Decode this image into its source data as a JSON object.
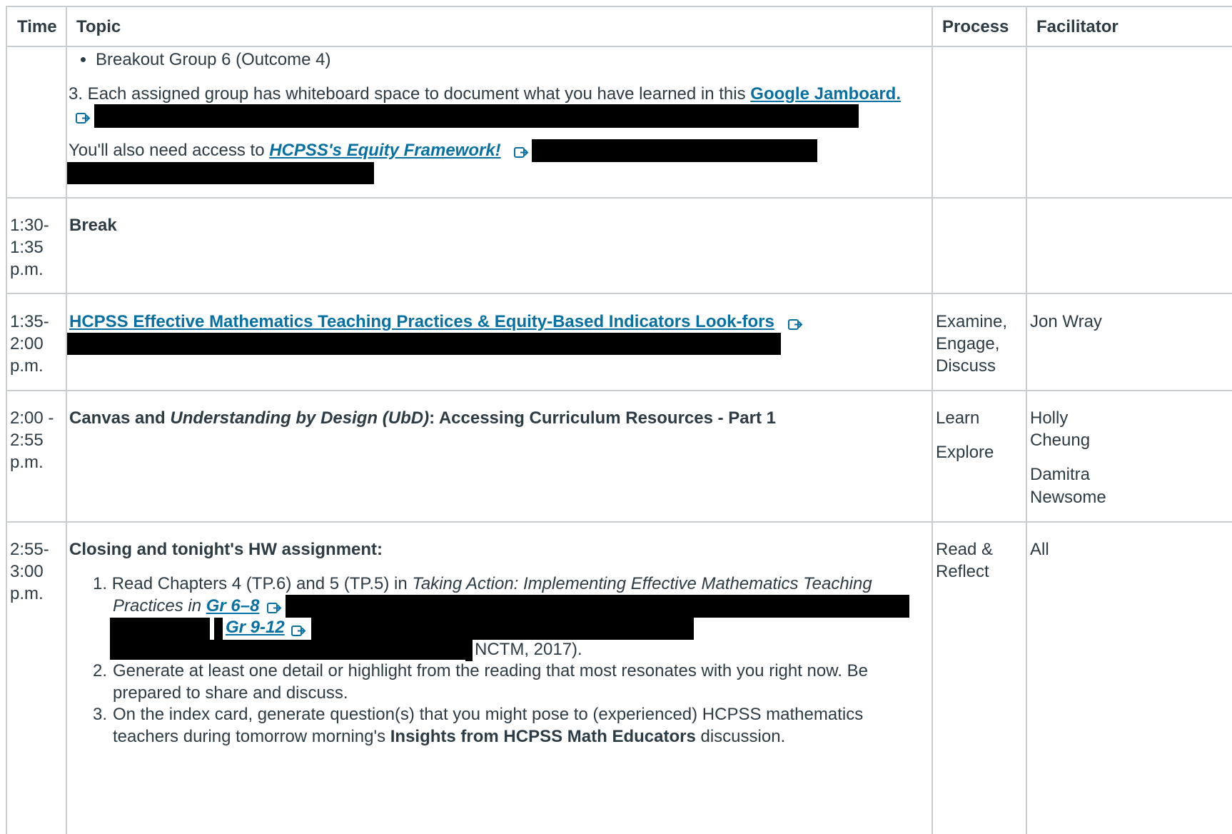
{
  "header": {
    "time": "Time",
    "topic": "Topic",
    "process": "Process",
    "facilitator": "Facilitator"
  },
  "row0": {
    "bullet": "Breakout Group 6 (Outcome 4)",
    "step3_text": "3. Each assigned group has whiteboard space to document what you have learned in this",
    "step3_link": "Google Jamboard.",
    "access_text": "You'll also need access to",
    "access_link": "HCPSS's Equity Framework!"
  },
  "row1": {
    "time": [
      "1:30-",
      "1:35",
      "p.m."
    ],
    "topic": "Break"
  },
  "row2": {
    "time": [
      "1:35-",
      "2:00",
      "p.m."
    ],
    "topic_link": "HCPSS Effective Mathematics Teaching Practices & Equity-Based Indicators Look-fors",
    "process": [
      "Examine,",
      "Engage,",
      "Discuss"
    ],
    "facilitator": "Jon Wray"
  },
  "row3": {
    "time": [
      "2:00 -",
      "2:55",
      "p.m."
    ],
    "topic_a": "Canvas and ",
    "topic_b": "Understanding by Design (UbD)",
    "topic_c": ": Accessing Curriculum Resources - Part 1",
    "process": [
      "Learn",
      "Explore"
    ],
    "facilitator1": [
      "Holly",
      "Cheung"
    ],
    "facilitator2": [
      "Damitra",
      "Newsome"
    ]
  },
  "row4": {
    "time": [
      "2:55-",
      "3:00",
      "p.m."
    ],
    "title": "Closing and tonight's HW assignment:",
    "item1_a": "Read Chapters 4 (TP.6) and 5 (TP.5) in ",
    "item1_b": "Taking Action: Implementing Effective Mathematics Teaching",
    "item1_c": "Practices in ",
    "item1_link1": "Gr 6–8",
    "item1_link2": "Gr 9-12",
    "item1_end": "NCTM, 2017).",
    "item2": "Generate at least one detail or highlight from the reading that most resonates with you right now. Be prepared to share and discuss.",
    "item3_a": "On the index card, generate question(s) that you might pose to (experienced) HCPSS mathematics teachers during tomorrow morning's ",
    "item3_b": "Insights from HCPSS Math Educators",
    "item3_c": " discussion.",
    "process": [
      "Read &",
      "Reflect"
    ],
    "facilitator": "All"
  }
}
